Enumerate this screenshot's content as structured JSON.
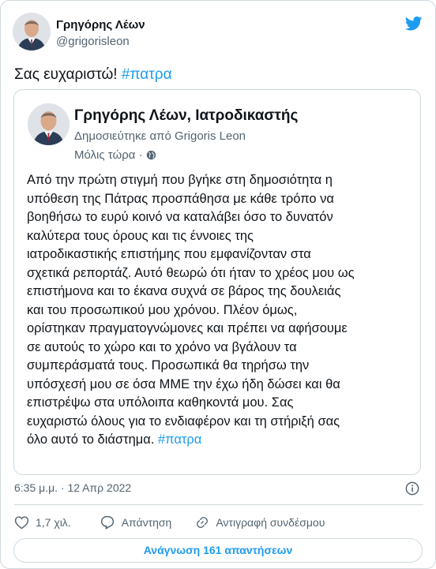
{
  "tweet": {
    "author_name": "Γρηγόρης Λέων",
    "author_handle": "@grigorisleon",
    "text_prefix": "Σας ευχαριστώ!",
    "text_hashtag": "#πατρα",
    "timestamp": "6:35 μ.μ. · 12 Απρ 2022"
  },
  "embed": {
    "author_name": "Γρηγόρης Λέων, Ιατροδικαστής",
    "published_by": "Δημοσιεύτηκε από Grigoris Leon",
    "time": "Μόλις τώρα ·",
    "body_lines": [
      "Από την πρώτη στιγμή που βγήκε στη δημοσιότητα η",
      "υπόθεση της Πάτρας προσπάθησα με κάθε τρόπο να",
      "βοηθήσω το ευρύ κοινό να καταλάβει όσο το δυνατόν",
      "καλύτερα τους όρους και τις έννοιες της",
      "ιατροδικαστικής επιστήμης που εμφανίζονταν στα",
      "σχετικά ρεπορτάζ. Αυτό θεωρώ ότι ήταν το χρέος μου ως",
      "επιστήμονα και το έκανα συχνά σε βάρος της δουλειάς",
      "και του προσωπικού μου χρόνου. Πλέον όμως,",
      "ορίστηκαν πραγματογνώμονες και πρέπει να αφήσουμε",
      "σε αυτούς το χώρο και το χρόνο να βγάλουν τα",
      "συμπεράσματά τους. Προσωπικά θα τηρήσω την",
      "υπόσχεσή μου σε όσα ΜΜΕ την έχω ήδη δώσει και θα",
      "επιστρέψω στα υπόλοιπα καθηκοντά μου. Σας",
      "ευχαριστώ όλους για το ενδιαφέρον και τη στήριξή σας"
    ],
    "last_line_prefix": "όλο αυτό το διάστημα.",
    "last_line_hashtag": "#πατρα"
  },
  "actions": {
    "likes": "1,7 χιλ.",
    "reply": "Απάντηση",
    "copy_link": "Αντιγραφή συνδέσμου"
  },
  "read_replies": "Ανάγνωση 161 απαντήσεων",
  "colors": {
    "accent": "#1d9bf0",
    "heart": "#536471",
    "border": "#cfd9de",
    "text": "#0f1419",
    "muted": "#536471"
  },
  "icons": [
    "twitter-bird-icon",
    "globe-icon",
    "info-icon",
    "heart-icon",
    "reply-icon",
    "link-icon"
  ]
}
